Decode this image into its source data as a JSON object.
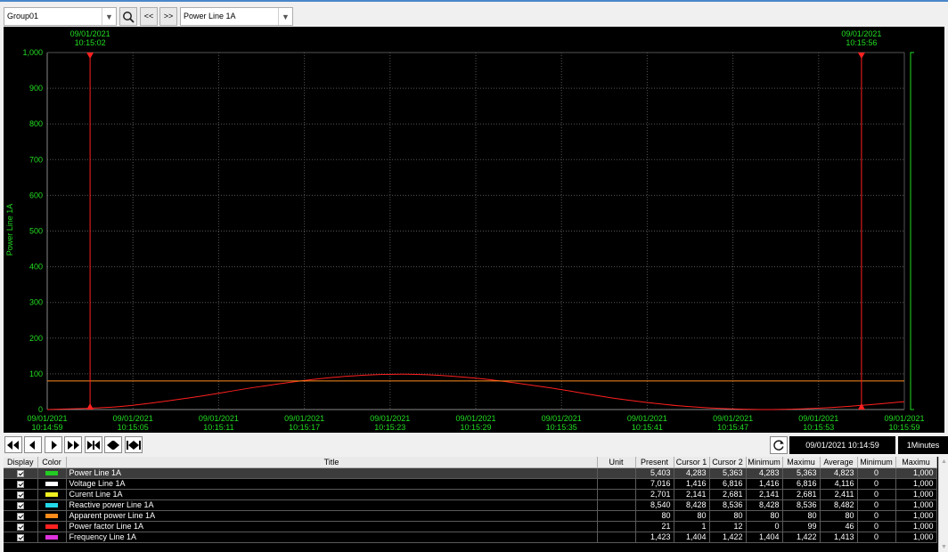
{
  "toolbar": {
    "group_value": "Group01",
    "prev_label": "<<",
    "next_label": ">>",
    "signal_value": "Power Line 1A"
  },
  "chart_data": {
    "type": "line",
    "ylabel": "Power Line 1A",
    "ylim": [
      0,
      1000
    ],
    "y_ticks": [
      "0",
      "100",
      "200",
      "300",
      "400",
      "500",
      "600",
      "700",
      "800",
      "900",
      "1,000"
    ],
    "x_ticks": [
      {
        "date": "09/01/2021",
        "time": "10:14:59"
      },
      {
        "date": "09/01/2021",
        "time": "10:15:05"
      },
      {
        "date": "09/01/2021",
        "time": "10:15:11"
      },
      {
        "date": "09/01/2021",
        "time": "10:15:17"
      },
      {
        "date": "09/01/2021",
        "time": "10:15:23"
      },
      {
        "date": "09/01/2021",
        "time": "10:15:29"
      },
      {
        "date": "09/01/2021",
        "time": "10:15:35"
      },
      {
        "date": "09/01/2021",
        "time": "10:15:41"
      },
      {
        "date": "09/01/2021",
        "time": "10:15:47"
      },
      {
        "date": "09/01/2021",
        "time": "10:15:53"
      },
      {
        "date": "09/01/2021",
        "time": "10:15:59"
      }
    ],
    "grid": true,
    "cursors": [
      {
        "name": "Cursor 1",
        "date": "09/01/2021",
        "time": "10:15:02",
        "t_seconds": 3
      },
      {
        "name": "Cursor 2",
        "date": "09/01/2021",
        "time": "10:15:56",
        "t_seconds": 57
      }
    ],
    "series": [
      {
        "name": "Power Line 1A",
        "color": "#ff2020",
        "x_seconds": [
          0,
          5,
          10,
          15,
          20,
          25,
          30,
          35,
          40,
          45,
          50,
          55,
          60
        ],
        "values": [
          0,
          8,
          33,
          65,
          90,
          99,
          88,
          62,
          30,
          8,
          0,
          6,
          22
        ]
      },
      {
        "name": "Apparent power Line 1A",
        "color": "#ff8c1a",
        "x_seconds": [
          0,
          60
        ],
        "values": [
          80,
          80
        ]
      }
    ]
  },
  "controls": {
    "datetime": "09/01/2021 10:14:59",
    "interval": "1Minutes"
  },
  "table": {
    "headers": [
      "Display",
      "Color",
      "Title",
      "Unit",
      "Present",
      "Cursor 1",
      "Cursor 2",
      "Minimum",
      "Maximu",
      "Average",
      "Minimum",
      "Maximu"
    ],
    "rows": [
      {
        "color": "#22cc22",
        "title": "Power Line 1A",
        "unit": "",
        "present": "5,403",
        "cursor1": "4,283",
        "cursor2": "5,363",
        "min": "4,283",
        "max": "5,363",
        "avg": "4,823",
        "scale_min": "0",
        "scale_max": "1,000"
      },
      {
        "color": "#ffffff",
        "title": "Voltage Line 1A",
        "unit": "",
        "present": "7,016",
        "cursor1": "1,416",
        "cursor2": "6,816",
        "min": "1,416",
        "max": "6,816",
        "avg": "4,116",
        "scale_min": "0",
        "scale_max": "1,000"
      },
      {
        "color": "#eeee22",
        "title": "Curent Line 1A",
        "unit": "",
        "present": "2,701",
        "cursor1": "2,141",
        "cursor2": "2,681",
        "min": "2,141",
        "max": "2,681",
        "avg": "2,411",
        "scale_min": "0",
        "scale_max": "1,000"
      },
      {
        "color": "#22d8e8",
        "title": "Reactive power Line 1A",
        "unit": "",
        "present": "8,540",
        "cursor1": "8,428",
        "cursor2": "8,536",
        "min": "8,428",
        "max": "8,536",
        "avg": "8,482",
        "scale_min": "0",
        "scale_max": "1,000"
      },
      {
        "color": "#ff8c1a",
        "title": "Apparent power Line 1A",
        "unit": "",
        "present": "80",
        "cursor1": "80",
        "cursor2": "80",
        "min": "80",
        "max": "80",
        "avg": "80",
        "scale_min": "0",
        "scale_max": "1,000"
      },
      {
        "color": "#ff2020",
        "title": "Power factor Line 1A",
        "unit": "",
        "present": "21",
        "cursor1": "1",
        "cursor2": "12",
        "min": "0",
        "max": "99",
        "avg": "46",
        "scale_min": "0",
        "scale_max": "1,000"
      },
      {
        "color": "#dd33dd",
        "title": "Frequency Line 1A",
        "unit": "",
        "present": "1,423",
        "cursor1": "1,404",
        "cursor2": "1,422",
        "min": "1,404",
        "max": "1,422",
        "avg": "1,413",
        "scale_min": "0",
        "scale_max": "1,000"
      }
    ]
  }
}
